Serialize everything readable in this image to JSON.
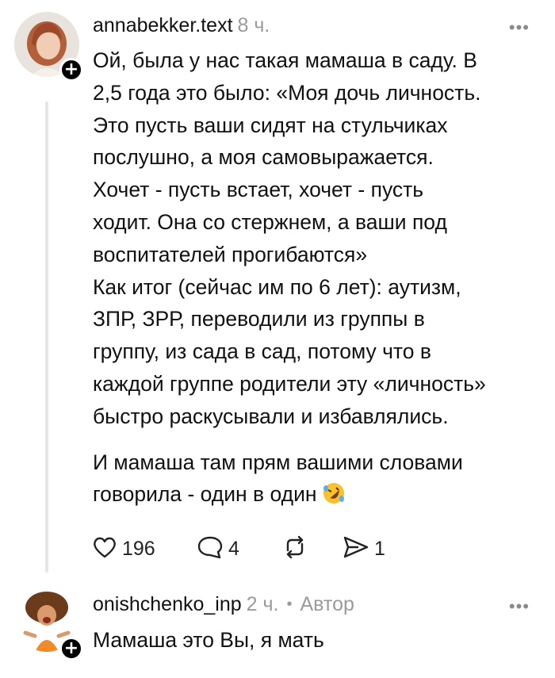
{
  "comments": [
    {
      "username": "annabekker.text",
      "time": "8 ч.",
      "paragraphs": [
        "Ой, была у нас такая мамаша в саду. В\n2,5 года это было: «Моя дочь личность.\nЭто пусть ваши сидят на стульчиках\nпослушно, а моя самовыражается.\nХочет - пусть встает, хочет - пусть\nходит. Она со стержнем, а ваши под\nвоспитателей прогибаются»\nКак итог (сейчас им по 6 лет): аутизм,\nЗПР, ЗРР, переводили из группы в\nгруппу, из сада в сад, потому что в\nкаждой группе родители эту «личность»\nбыстро раскусывали и избавлялись.",
        "И мамаша там прям вашими словами\nговорила - один в один"
      ],
      "emoji": "rolling-on-floor-laughing",
      "likes": "196",
      "replies": "4",
      "shares": "1"
    },
    {
      "username": "onishchenko_inp",
      "time": "2 ч.",
      "separator": "•",
      "author_label": "Автор",
      "text": "Мамаша это Вы, я мать"
    }
  ],
  "more_label": "•••",
  "plus_label": "+",
  "colors": {
    "text": "#111111",
    "muted": "#9a9a9a",
    "thread": "#e6e6e6",
    "badge": "#000000"
  }
}
